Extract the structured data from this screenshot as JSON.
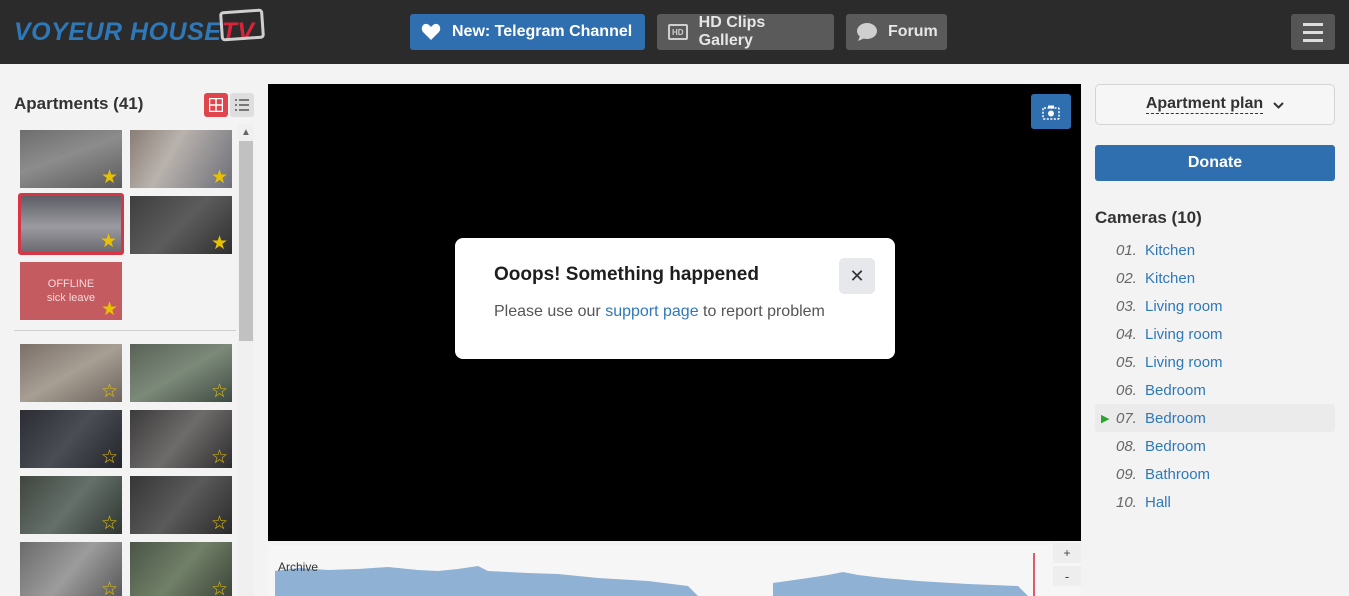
{
  "header": {
    "logo_brand": "VOYEUR HOUSE",
    "logo_suffix": "TV",
    "buttons": {
      "telegram": "New: Telegram Channel",
      "clips": "HD Clips Gallery",
      "forum": "Forum"
    },
    "hd_badge": "HD"
  },
  "sidebar": {
    "title": "Apartments (41)",
    "offline_label": "OFFLINE",
    "offline_sub": "sick leave"
  },
  "timeline": {
    "label": "Archive",
    "zoom_in": "+",
    "zoom_out": "-"
  },
  "modal": {
    "title": "Ooops! Something happened",
    "msg_before": "Please use our",
    "link_text": "support page",
    "msg_after": "to report problem",
    "close": "✕"
  },
  "right": {
    "plan_label": "Apartment plan",
    "donate_label": "Donate",
    "cameras_title": "Cameras (10)",
    "cameras": [
      {
        "num": "01.",
        "name": "Kitchen"
      },
      {
        "num": "02.",
        "name": "Kitchen"
      },
      {
        "num": "03.",
        "name": "Living room"
      },
      {
        "num": "04.",
        "name": "Living room"
      },
      {
        "num": "05.",
        "name": "Living room"
      },
      {
        "num": "06.",
        "name": "Bedroom"
      },
      {
        "num": "07.",
        "name": "Bedroom"
      },
      {
        "num": "08.",
        "name": "Bedroom"
      },
      {
        "num": "09.",
        "name": "Bathroom"
      },
      {
        "num": "10.",
        "name": "Hall"
      }
    ],
    "active_camera_index": 6
  },
  "colors": {
    "accent_blue": "#2f6fb0",
    "accent_red": "#d9233c",
    "header_bg": "#2b2b2b",
    "star": "#e8c200"
  },
  "icons": [
    "heart-icon",
    "hd-icon",
    "speech-bubble-icon",
    "hamburger-icon",
    "grid-view-icon",
    "list-view-icon",
    "star-icon",
    "camera-snapshot-icon",
    "close-icon",
    "chevron-down-icon",
    "play-icon"
  ]
}
